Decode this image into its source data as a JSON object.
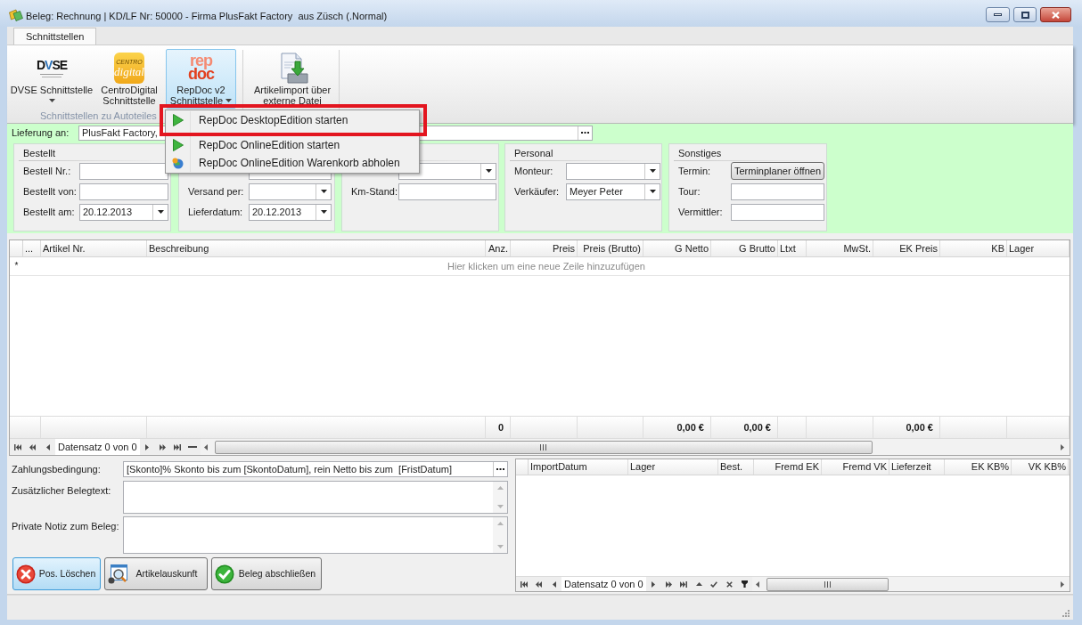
{
  "window": {
    "title": "Beleg: Rechnung | KD/LF Nr: 50000 - Firma PlusFakt Factory  aus Züsch (.Normal)"
  },
  "tabs": [
    {
      "label": "Schnittstellen",
      "selected": true
    }
  ],
  "ribbon": {
    "groups": [
      {
        "label": "Schnittstellen zu Autoteiles",
        "buttons": [
          {
            "kind": "dvse",
            "logo_text": [
              "DVSE"
            ],
            "label": [
              "DVSE Schnittstelle"
            ],
            "dropdown": true,
            "selected": false
          },
          {
            "kind": "centro",
            "logo_text": [
              "CENTRO",
              "digital"
            ],
            "label": [
              "CentroDigital",
              "Schnittstelle"
            ],
            "dropdown": false,
            "selected": false
          },
          {
            "kind": "repdoc",
            "logo_text": [
              "rep",
              "doc"
            ],
            "label": [
              "RepDoc v2",
              "Schnittstelle"
            ],
            "dropdown": true,
            "selected": true
          }
        ]
      },
      {
        "buttons": [
          {
            "kind": "import",
            "label": [
              "Artikelimport über",
              "externe Datei"
            ],
            "dropdown": false,
            "selected": false
          }
        ]
      }
    ]
  },
  "menu": {
    "items": [
      {
        "kind": "start",
        "label": "RepDoc DesktopEdition starten",
        "marked": true
      },
      {
        "kind": "start",
        "label": "RepDoc OnlineEdition starten",
        "marked": false
      },
      {
        "kind": "fetch",
        "label": "RepDoc OnlineEdition Warenkorb abholen",
        "marked": false
      }
    ]
  },
  "delivery": {
    "label": "Lieferung an:",
    "value": "PlusFakt Factory,"
  },
  "form_groups": [
    {
      "title": "Bestellt",
      "fields": [
        {
          "kind": "text",
          "label": "Bestell Nr.:"
        },
        {
          "kind": "text",
          "label": "Bestellt von:"
        },
        {
          "kind": "combo",
          "label": "Bestellt am:",
          "value": "20.12.2013"
        }
      ]
    },
    {
      "fields": [
        {
          "kind": "text"
        },
        {
          "kind": "combo",
          "label": "Versand per:"
        },
        {
          "kind": "combo",
          "label": "Lieferdatum:",
          "value": "20.12.2013"
        }
      ]
    },
    {
      "fields": [
        {
          "kind": "combo"
        },
        {
          "kind": "text",
          "label": "Km-Stand:"
        }
      ]
    },
    {
      "title": "Personal",
      "fields": [
        {
          "kind": "combo",
          "label": "Monteur:"
        },
        {
          "kind": "combo",
          "label": "Verkäufer:",
          "value": "Meyer Peter"
        }
      ]
    },
    {
      "title": "Sonstiges",
      "fields": [
        {
          "kind": "button",
          "label": "Termin:",
          "value": "Terminplaner öffnen"
        },
        {
          "kind": "text",
          "label": "Tour:"
        },
        {
          "kind": "text",
          "label": "Vermittler:"
        }
      ]
    }
  ],
  "positions_grid": {
    "columns": [
      {
        "label": "...",
        "right_aligned": false
      },
      {
        "label": "Artikel Nr.",
        "right_aligned": false
      },
      {
        "label": "Beschreibung",
        "right_aligned": false
      },
      {
        "label": "Anz.",
        "right_aligned": true,
        "total": "0"
      },
      {
        "label": "Preis",
        "right_aligned": true
      },
      {
        "label": "Preis (Brutto)",
        "right_aligned": true
      },
      {
        "label": "G Netto",
        "right_aligned": true,
        "total": "0,00 €"
      },
      {
        "label": "G Brutto",
        "right_aligned": true,
        "total": "0,00 €"
      },
      {
        "label": "Ltxt",
        "right_aligned": false
      },
      {
        "label": "MwSt.",
        "right_aligned": true
      },
      {
        "label": "EK Preis",
        "right_aligned": true,
        "total": "0,00 €"
      },
      {
        "label": "KB",
        "right_aligned": true
      },
      {
        "label": "Lager",
        "right_aligned": false
      }
    ],
    "new_row": {
      "marker": "*",
      "text": "Hier klicken um eine neue Zeile hinzuzufügen"
    },
    "navigator": {
      "before": [
        {
          "kind": "first"
        },
        {
          "kind": "prev_page"
        },
        {
          "kind": "prev"
        }
      ],
      "text": "Datensatz 0 von 0",
      "after": [
        {
          "kind": "next"
        },
        {
          "kind": "next_page"
        },
        {
          "kind": "last"
        },
        {
          "kind": "remove"
        }
      ]
    }
  },
  "notes": [
    {
      "kind": "line",
      "label": "Zahlungsbedingung:",
      "value": "[Skonto]% Skonto bis zum [SkontoDatum], rein Netto bis zum  [FristDatum]"
    },
    {
      "kind": "memo",
      "label": "Zusätzlicher Belegtext:"
    },
    {
      "kind": "memo",
      "label": "Private Notiz zum Beleg:"
    }
  ],
  "actions": [
    {
      "kind": "delete",
      "label": "Pos. Löschen",
      "focused": true
    },
    {
      "kind": "lookup",
      "label": "Artikelauskunft",
      "focused": false
    },
    {
      "kind": "finish",
      "label": "Beleg abschließen",
      "focused": false
    }
  ],
  "stock_grid": {
    "columns": [
      {
        "label": "ImportDatum",
        "right_aligned": false
      },
      {
        "label": "Lager",
        "right_aligned": false
      },
      {
        "label": "Best.",
        "right_aligned": false
      },
      {
        "label": "Fremd EK",
        "right_aligned": true
      },
      {
        "label": "Fremd VK",
        "right_aligned": true
      },
      {
        "label": "Lieferzeit",
        "right_aligned": false
      },
      {
        "label": "EK KB%",
        "right_aligned": true
      },
      {
        "label": "VK KB%",
        "right_aligned": true
      }
    ],
    "navigator": {
      "before": [
        {
          "kind": "first"
        },
        {
          "kind": "prev_page"
        },
        {
          "kind": "prev"
        }
      ],
      "text": "Datensatz 0 von 0",
      "after": [
        {
          "kind": "next"
        },
        {
          "kind": "next_page"
        },
        {
          "kind": "last"
        },
        {
          "kind": "up"
        },
        {
          "kind": "confirm"
        },
        {
          "kind": "cancel"
        },
        {
          "kind": "filter"
        }
      ]
    }
  }
}
